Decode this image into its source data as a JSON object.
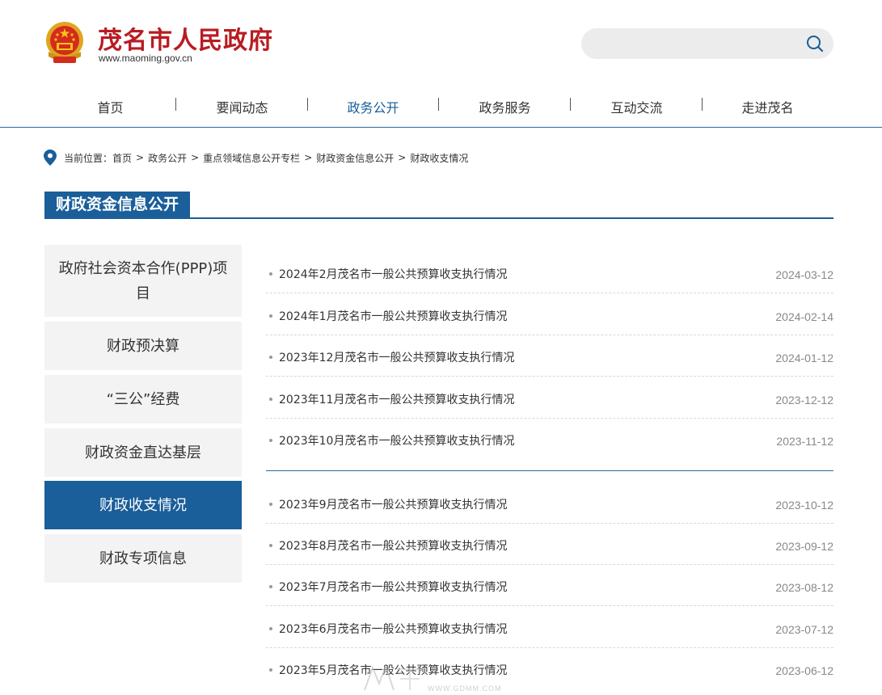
{
  "header": {
    "site_name": "茂名市人民政府",
    "site_url": "www.maoming.gov.cn",
    "search_placeholder": ""
  },
  "nav": {
    "items": [
      {
        "label": "首页",
        "active": false
      },
      {
        "label": "要闻动态",
        "active": false
      },
      {
        "label": "政务公开",
        "active": true
      },
      {
        "label": "政务服务",
        "active": false
      },
      {
        "label": "互动交流",
        "active": false
      },
      {
        "label": "走进茂名",
        "active": false
      }
    ]
  },
  "breadcrumb": {
    "prefix": "当前位置：",
    "items": [
      "首页",
      "政务公开",
      "重点领域信息公开专栏",
      "财政资金信息公开",
      "财政收支情况"
    ],
    "separator": ">"
  },
  "section": {
    "title": "财政资金信息公开"
  },
  "sidebar": {
    "items": [
      {
        "label": "政府社会资本合作(PPP)项目",
        "active": false
      },
      {
        "label": "财政预决算",
        "active": false
      },
      {
        "label": "“三公”经费",
        "active": false
      },
      {
        "label": "财政资金直达基层",
        "active": false
      },
      {
        "label": "财政收支情况",
        "active": true
      },
      {
        "label": "财政专项信息",
        "active": false
      }
    ]
  },
  "list": {
    "items": [
      {
        "title": "2024年2月茂名市一般公共预算收支执行情况",
        "date": "2024-03-12"
      },
      {
        "title": "2024年1月茂名市一般公共预算收支执行情况",
        "date": "2024-02-14"
      },
      {
        "title": "2023年12月茂名市一般公共预算收支执行情况",
        "date": "2024-01-12"
      },
      {
        "title": "2023年11月茂名市一般公共预算收支执行情况",
        "date": "2023-12-12"
      },
      {
        "title": "2023年10月茂名市一般公共预算收支执行情况",
        "date": "2023-11-12"
      },
      {
        "title": "2023年9月茂名市一般公共预算收支执行情况",
        "date": "2023-10-12"
      },
      {
        "title": "2023年8月茂名市一般公共预算收支执行情况",
        "date": "2023-09-12"
      },
      {
        "title": "2023年7月茂名市一般公共预算收支执行情况",
        "date": "2023-08-12"
      },
      {
        "title": "2023年6月茂名市一般公共预算收支执行情况",
        "date": "2023-07-12"
      },
      {
        "title": "2023年5月茂名市一般公共预算收支执行情况",
        "date": "2023-06-12"
      }
    ]
  },
  "watermark": {
    "text": "WWW.GDMM.COM"
  },
  "colors": {
    "brand_red": "#b81c22",
    "accent_blue": "#1a5e9a",
    "sidebar_bg": "#f3f3f3",
    "date_gray": "#888888"
  }
}
